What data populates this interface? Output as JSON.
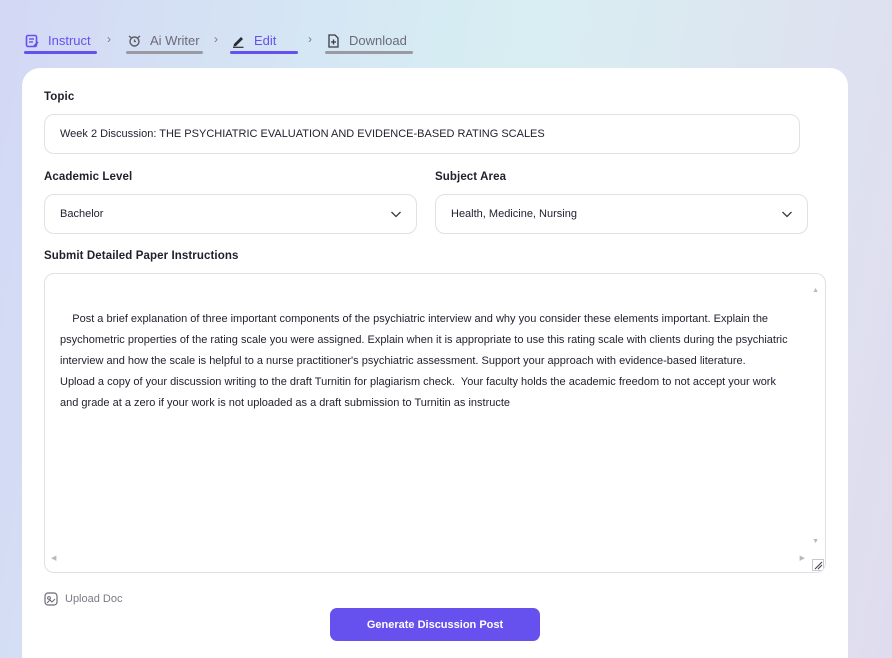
{
  "stepper": {
    "steps": [
      {
        "label": "Instruct",
        "icon": "instruct-icon",
        "state": "active"
      },
      {
        "label": "Ai Writer",
        "icon": "ai-writer-icon",
        "state": "inactive"
      },
      {
        "label": "Edit",
        "icon": "edit-icon",
        "state": "active"
      },
      {
        "label": "Download",
        "icon": "download-icon",
        "state": "inactive"
      }
    ],
    "separator": "›"
  },
  "form": {
    "topic": {
      "label": "Topic",
      "value": "Week 2 Discussion: THE PSYCHIATRIC EVALUATION AND EVIDENCE-BASED RATING SCALES"
    },
    "academic_level": {
      "label": "Academic Level",
      "value": "Bachelor"
    },
    "subject_area": {
      "label": "Subject Area",
      "value": "Health, Medicine, Nursing"
    },
    "instructions": {
      "label": "Submit Detailed Paper Instructions",
      "value": "Post a brief explanation of three important components of the psychiatric interview and why you consider these elements important. Explain the psychometric properties of the rating scale you were assigned. Explain when it is appropriate to use this rating scale with clients during the psychiatric interview and how the scale is helpful to a nurse practitioner's psychiatric assessment. Support your approach with evidence-based literature.\nUpload a copy of your discussion writing to the draft Turnitin for plagiarism check.  Your faculty holds the academic freedom to not accept your work and grade at a zero if your work is not uploaded as a draft submission to Turnitin as instructe"
    },
    "upload_label": "Upload Doc",
    "generate_label": "Generate Discussion Post"
  },
  "colors": {
    "accent": "#6650ee",
    "inactive": "#9a9aa3",
    "card": "#ffffff",
    "border": "#e0e0e6"
  }
}
